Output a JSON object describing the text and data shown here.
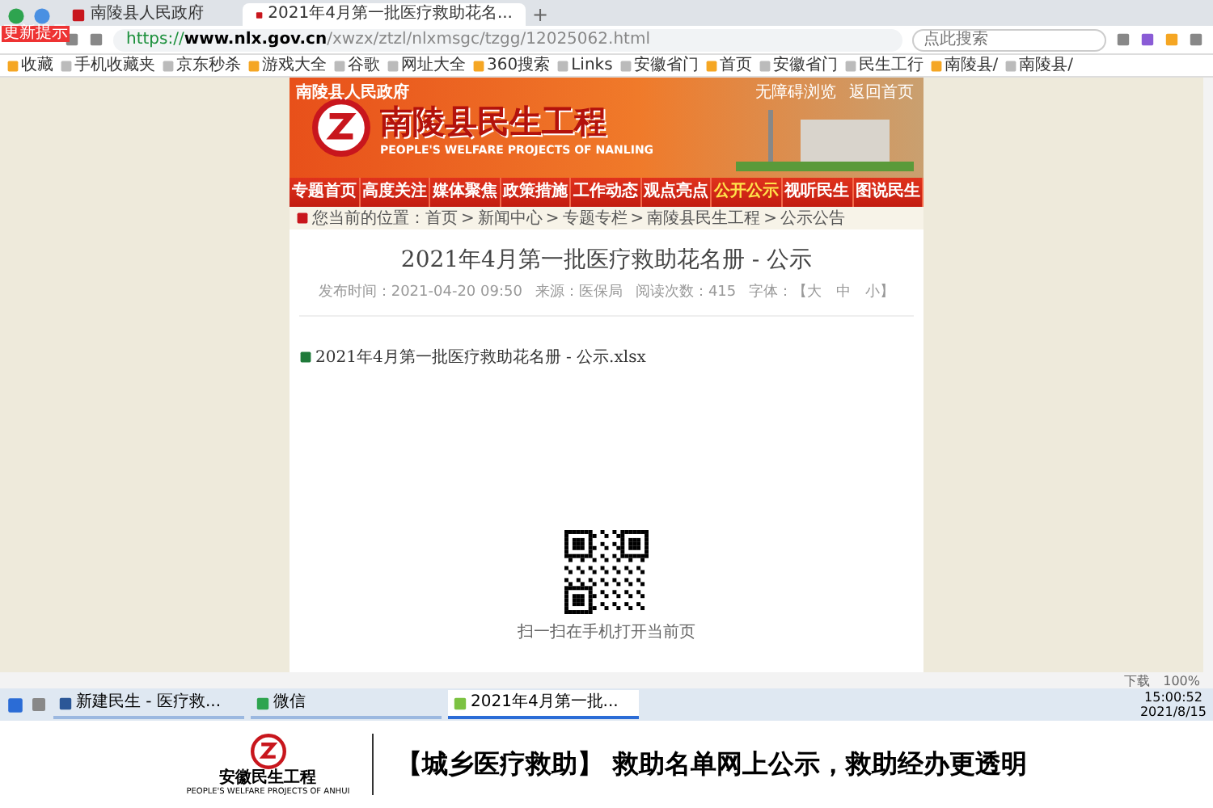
{
  "browser": {
    "badge": "更新提示",
    "tabs": [
      {
        "title": "南陵县人民政府",
        "selected": false
      },
      {
        "title": "2021年4月第一批医疗救助花名...",
        "selected": true
      }
    ],
    "new_tab": "+",
    "url_prefix": "https://",
    "url_host": "www.nlx.gov.cn",
    "url_path": "/xwzx/ztzl/nlxmsgc/tzgg/12025062.html",
    "search": {
      "placeholder": "点此搜索"
    },
    "bookmarks": [
      "收藏",
      "手机收藏夹",
      "京东秒杀",
      "游戏大全",
      "谷歌",
      "网址大全",
      "360搜索",
      "Links",
      "安徽省门",
      "首页",
      "安徽省门",
      "民生工行",
      "南陵县/",
      "南陵县/"
    ]
  },
  "page": {
    "gov_name": "南陵县人民政府",
    "top_links": [
      "无障碍浏览",
      "返回首页"
    ],
    "site_title": "南陵县民生工程",
    "site_subtitle": "PEOPLE'S WELFARE PROJECTS OF NANLING",
    "nav": [
      {
        "label": "专题首页",
        "selected": false
      },
      {
        "label": "高度关注",
        "selected": false
      },
      {
        "label": "媒体聚焦",
        "selected": false
      },
      {
        "label": "政策措施",
        "selected": false
      },
      {
        "label": "工作动态",
        "selected": false
      },
      {
        "label": "观点亮点",
        "selected": false
      },
      {
        "label": "公开公示",
        "selected": true
      },
      {
        "label": "视听民生",
        "selected": false
      },
      {
        "label": "图说民生",
        "selected": false
      }
    ],
    "breadcrumb_separator": ">",
    "breadcrumb": [
      "您当前的位置：首页",
      "新闻中心",
      "专题专栏",
      "南陵县民生工程",
      "公示公告"
    ],
    "article": {
      "title": "2021年4月第一批医疗救助花名册 - 公示",
      "meta": [
        "发布时间：2021-04-20 09:50",
        "来源：医保局",
        "阅读次数：415",
        "字体：【大　中　小】"
      ],
      "attachment": "2021年4月第一批医疗救助花名册 - 公示.xlsx",
      "qr_caption": "扫一扫在手机打开当前页"
    }
  },
  "status_bar": {
    "download": "下载",
    "zoom": "100%"
  },
  "taskbar": {
    "items": [
      {
        "label": "新建民生 - 医疗救...",
        "kind": "word",
        "selected": false
      },
      {
        "label": "微信",
        "kind": "chat",
        "selected": false
      },
      {
        "label": "2021年4月第一批...",
        "kind": "browser",
        "selected": true
      }
    ],
    "time": "15:00:52",
    "date": "2021/8/15"
  },
  "caption": {
    "logo_text": "安徽民生工程",
    "logo_subtitle": "PEOPLE'S WELFARE PROJECTS OF ANHUI",
    "headline": "【城乡医疗救助】 救助名单网上公示，救助经办更透明"
  }
}
